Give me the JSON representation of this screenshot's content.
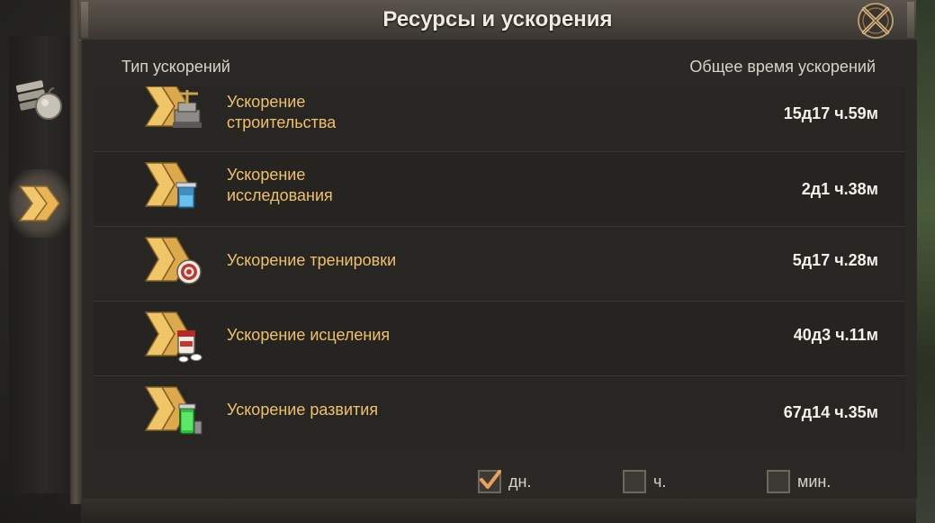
{
  "window": {
    "title": "Ресурсы и ускорения"
  },
  "side_tabs": [
    {
      "id": "resources",
      "icon": "resources-icon",
      "active": false
    },
    {
      "id": "speedups",
      "icon": "double-chevron-icon",
      "active": true
    }
  ],
  "table": {
    "col_type": "Тип ускорений",
    "col_total": "Общее время ускорений",
    "rows": [
      {
        "label": "Ускорение строительства",
        "label_line1": "Ускорение",
        "label_line2": "строительства",
        "value": "15д17 ч.59м",
        "icon": "construction-speedup-icon"
      },
      {
        "label": "Ускорение исследования",
        "label_line1": "Ускорение",
        "label_line2": "исследования",
        "value": "2д1 ч.38м",
        "icon": "research-speedup-icon"
      },
      {
        "label": "Ускорение тренировки",
        "value": "5д17 ч.28м",
        "icon": "training-speedup-icon"
      },
      {
        "label": "Ускорение исцеления",
        "value": "40д3 ч.11м",
        "icon": "healing-speedup-icon"
      },
      {
        "label": "Ускорение развития",
        "value": "67д14 ч.35м",
        "icon": "development-speedup-icon"
      }
    ]
  },
  "units": [
    {
      "label": "дн.",
      "checked": true
    },
    {
      "label": "ч.",
      "checked": false
    },
    {
      "label": "мин.",
      "checked": false
    }
  ],
  "colors": {
    "accent_gold": "#f0c06a",
    "value_text": "#f5f1ea",
    "checkmark": "#e8a35a"
  }
}
